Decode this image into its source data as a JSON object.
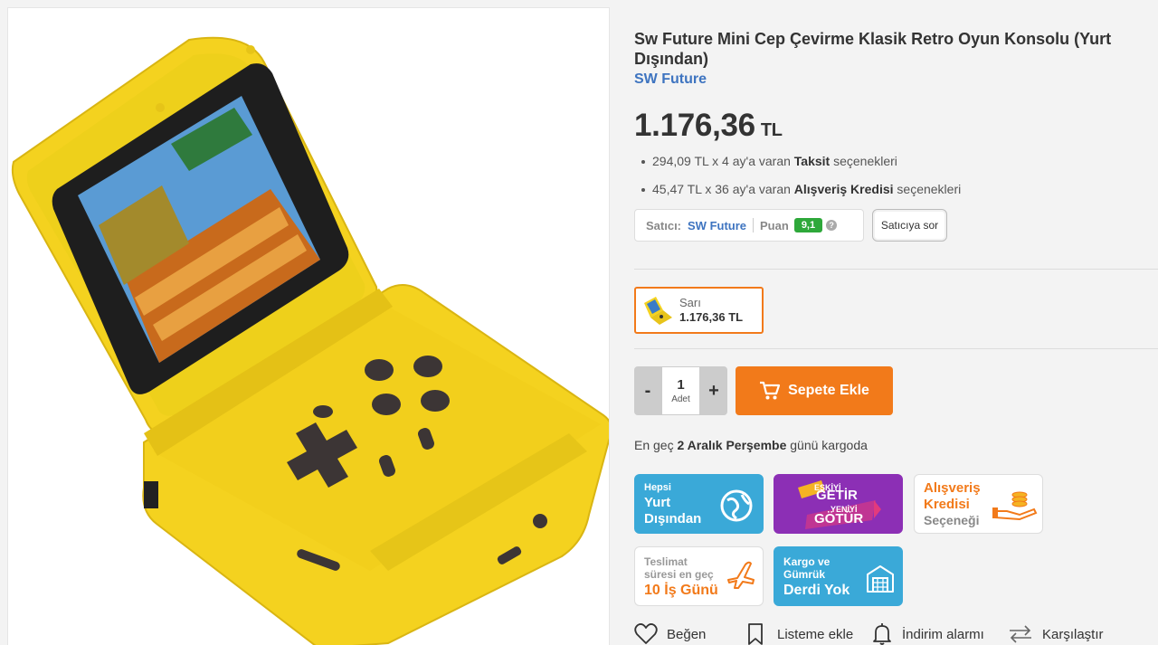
{
  "product": {
    "title": "Sw Future Mini Cep Çevirme Klasik Retro Oyun Konsolu (Yurt Dışından)",
    "brand": "SW Future",
    "price": "1.176,36",
    "currency": "TL",
    "installment": {
      "pre": "294,09 TL x 4 ay'a varan ",
      "bold": "Taksit",
      "post": " seçenekleri"
    },
    "credit": {
      "pre": "45,47 TL x 36 ay'a varan ",
      "bold": "Alışveriş Kredisi",
      "post": " seçenekleri"
    }
  },
  "seller": {
    "label": "Satıcı:",
    "name": "SW Future",
    "score_label": "Puan",
    "score": "9,1",
    "help": "?",
    "ask_button": "Satıcıya sor"
  },
  "variant": {
    "color": "Sarı",
    "price": "1.176,36 TL"
  },
  "quantity": {
    "minus": "-",
    "value": "1",
    "unit": "Adet",
    "plus": "+"
  },
  "cart": {
    "button": "Sepete Ekle"
  },
  "delivery": {
    "pre": "En geç ",
    "date": "2 Aralık Perşembe",
    "post": " günü kargoda"
  },
  "badges": [
    {
      "line1": "Hepsi",
      "line2": "Yurt",
      "line3": "Dışından",
      "color": "#3aa9d8"
    },
    {
      "line1": "ESKİYİ",
      "line2": "GETİR",
      "line3": "YENİYİ",
      "line4": "GÖTÜR",
      "color": "#8c2fb5"
    },
    {
      "line1": "Alışveriş",
      "line2": "Kredisi",
      "line3": "Seçeneği",
      "color": "#f27a1a"
    },
    {
      "line1": "Teslimat",
      "line2": "süresi en geç",
      "line3": "10 İş Günü",
      "color": "#f27a1a"
    },
    {
      "line1": "Kargo ve",
      "line2": "Gümrük",
      "line3": "Derdi Yok",
      "color": "#3aa9d8"
    }
  ],
  "actions": {
    "like": "Beğen",
    "list": "Listeme ekle",
    "price_alarm": "İndirim alarmı",
    "compare": "Karşılaştır"
  }
}
